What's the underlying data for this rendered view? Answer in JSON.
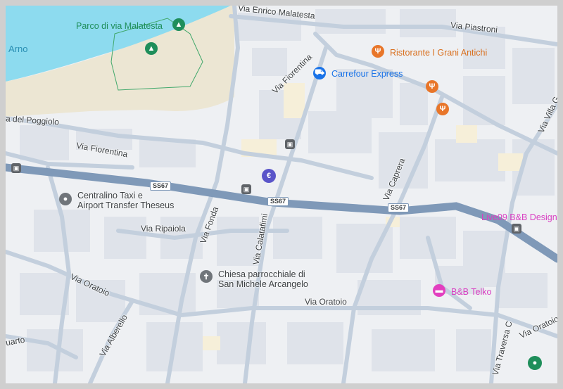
{
  "map": {
    "water_label": "Arno",
    "roads": {
      "highway": "SS67",
      "labels": [
        "Via Enrico Malatesta",
        "Via Piastroni",
        "Via Fiorentina",
        "Via Fiorentina",
        "a del Poggiolo",
        "Via Ripaiola",
        "Via Fonda",
        "Via Calatafimi",
        "Via Caprera",
        "Via Oratoio",
        "Via Oratoio",
        "Via Oratoio",
        "Via Alberello",
        "uarto",
        "Via Villa G",
        "Via Traversa C"
      ]
    },
    "places": {
      "park": "Parco di via Malatesta",
      "restaurant": "Ristorante I Grani Antichi",
      "supermarket": "Carrefour Express",
      "taxi_line1": "Centralino Taxi e",
      "taxi_line2": "Airport Transfer Theseus",
      "church_line1": "Chiesa parrocchiale di",
      "church_line2": "San Michele Arcangelo",
      "bb1": "B&B Telko",
      "bb2": "Live09 B&B Design"
    },
    "icons": {
      "park": "tree-icon",
      "restaurant": "fork-knife-icon",
      "supermarket": "shopping-cart-icon",
      "atm": "euro-icon",
      "bus": "bus-icon",
      "taxi": "location-pin-icon",
      "church": "cross-icon",
      "hotel": "bed-icon"
    },
    "colors": {
      "water": "#8ddbef",
      "park": "#ece6d3",
      "highway": "#7f99b8",
      "road": "#b9c7d8",
      "building": "#dde2ea",
      "restaurant": "#e8762a",
      "supermarket": "#1a73e8",
      "atm": "#5a55c9",
      "hotel": "#e23fbf",
      "park_pin": "#1e8e5a"
    }
  }
}
